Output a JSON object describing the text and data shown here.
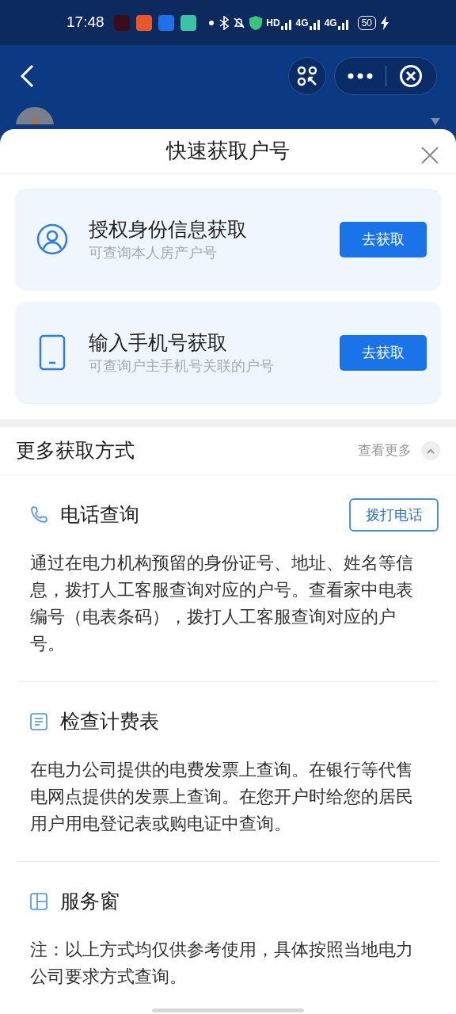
{
  "status_bar": {
    "time": "17:48",
    "network_labels": [
      "HD",
      "4G",
      "4G"
    ],
    "battery": "50"
  },
  "sheet": {
    "title": "快速获取户号",
    "options": [
      {
        "kind": "identity",
        "title": "授权身份信息获取",
        "subtitle": "可查询本人房产户号",
        "button": "去获取"
      },
      {
        "kind": "phone",
        "title": "输入手机号获取",
        "subtitle": "可查询户主手机号关联的户号",
        "button": "去获取"
      }
    ],
    "more": {
      "title": "更多获取方式",
      "toggle": "查看更多",
      "expanded": true,
      "sections": [
        {
          "kind": "call",
          "title": "电话查询",
          "button": "拨打电话",
          "text": "通过在电力机构预留的身份证号、地址、姓名等信息，拨打人工客服查询对应的户号。查看家中电表编号（电表条码），拨打人工客服查询对应的户号。"
        },
        {
          "kind": "bill",
          "title": "检查计费表",
          "text": "在电力公司提供的电费发票上查询。在银行等代售电网点提供的发票上查询。在您开户时给您的居民用户用电登记表或购电证中查询。"
        },
        {
          "kind": "window",
          "title": "服务窗",
          "text": "注：以上方式均仅供参考使用，具体按照当地电力公司要求方式查询。"
        }
      ]
    }
  }
}
